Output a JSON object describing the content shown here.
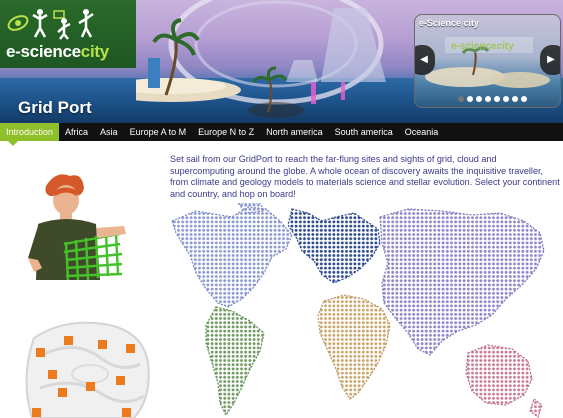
{
  "logo": {
    "text_main": "e-science",
    "text_accent": "city"
  },
  "banner": {
    "title": "Grid Port"
  },
  "slideshow": {
    "title": "e-Science city",
    "overlay_text": "e-sciencecity",
    "prev_icon": "arrow-left",
    "next_icon": "arrow-right",
    "dot_count": 8,
    "active_dot": 0
  },
  "tabs": [
    {
      "label": "Introduction",
      "active": true
    },
    {
      "label": "Africa",
      "active": false
    },
    {
      "label": "Asia",
      "active": false
    },
    {
      "label": "Europe A to M",
      "active": false
    },
    {
      "label": "Europe N to Z",
      "active": false
    },
    {
      "label": "North america",
      "active": false
    },
    {
      "label": "South america",
      "active": false
    },
    {
      "label": "Oceania",
      "active": false
    }
  ],
  "intro_text": "Set sail from our GridPort to reach the far-flung sites and sights of grid, cloud and supercomputing around the globe. A whole ocean of discovery awaits the inquisitive traveller, from climate and geology models to materials science and stellar evolution. Select your continent and country, and hop on board!",
  "colors": {
    "tab_active": "#8fbf2a",
    "tab_bar": "#111111",
    "intro_text": "#3a3a8a",
    "north_america": "#8a9ad0",
    "south_america": "#6e9a62",
    "europe": "#2c4a8c",
    "africa": "#c9a56a",
    "asia": "#8e86c9",
    "oceania": "#c97a96"
  }
}
